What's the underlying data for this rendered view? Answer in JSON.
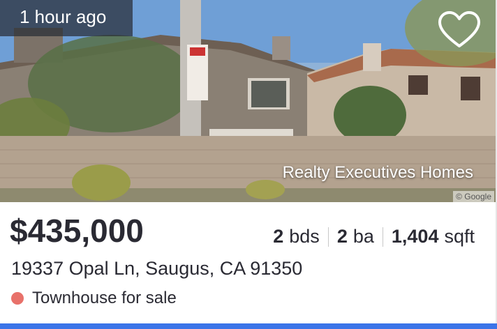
{
  "listing": {
    "time_badge": "1 hour ago",
    "brokerage": "Realty Executives Homes",
    "photo_credit": "© Google",
    "price": "$435,000",
    "beds_value": "2",
    "beds_unit": "bds",
    "baths_value": "2",
    "baths_unit": "ba",
    "sqft_value": "1,404",
    "sqft_unit": "sqft",
    "address": "19337 Opal Ln, Saugus, CA 91350",
    "status": "Townhouse for sale",
    "favorite_icon": "heart-outline-icon"
  },
  "colors": {
    "status_dot": "#e8716a",
    "accent_bar": "#3b74e8",
    "text": "#2a2a33"
  }
}
